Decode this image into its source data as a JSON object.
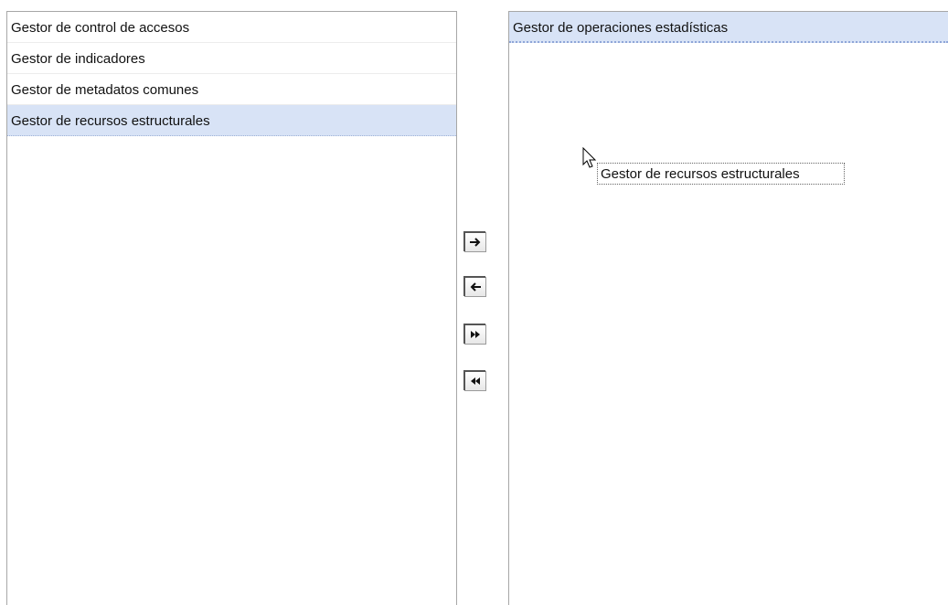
{
  "left_list": {
    "items": [
      {
        "label": "Gestor de control de accesos"
      },
      {
        "label": "Gestor de indicadores"
      },
      {
        "label": "Gestor de metadatos comunes"
      },
      {
        "label": "Gestor de recursos estructurales",
        "selected": true
      }
    ]
  },
  "right_list": {
    "items": [
      {
        "label": "Gestor de operaciones estadísticas",
        "selected": true
      }
    ]
  },
  "buttons": {
    "move_right": "arrow-right-icon",
    "move_left": "arrow-left-icon",
    "move_all_right": "double-arrow-right-icon",
    "move_all_left": "double-arrow-left-icon"
  },
  "drag": {
    "label": "Gestor de recursos estructurales"
  },
  "colors": {
    "selection": "#d8e3f6",
    "border": "#a7a7a7"
  }
}
